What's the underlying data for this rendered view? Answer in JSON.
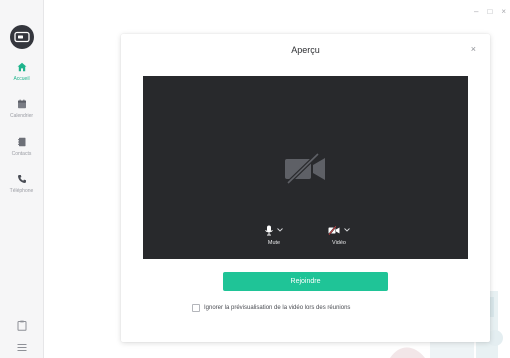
{
  "window": {
    "minimize": "–",
    "maximize": "□",
    "close": "×"
  },
  "sidebar": {
    "logo_icon": "app-logo-icon",
    "items": [
      {
        "label": "Accueil",
        "icon": "home-icon",
        "active": true
      },
      {
        "label": "Calendrier",
        "icon": "calendar-icon",
        "active": false
      },
      {
        "label": "Contacts",
        "icon": "contacts-icon",
        "active": false
      },
      {
        "label": "Téléphone",
        "icon": "phone-icon",
        "active": false
      }
    ],
    "bottom_icons": [
      "clipboard-icon",
      "menu-icon"
    ]
  },
  "dialog": {
    "title": "Aperçu",
    "close": "×",
    "preview": {
      "camera_state_icon": "camera-off-icon"
    },
    "controls": {
      "mute_label": "Mute",
      "video_label": "Vidéo"
    },
    "join_label": "Rejoindre",
    "skip_preview_label": "Ignorer la prévisualisation de la vidéo lors des réunions",
    "skip_preview_checked": false
  },
  "colors": {
    "accent": "#1fc497",
    "active_nav": "#1fb48c",
    "preview_bg": "#28292c",
    "sidebar_bg": "#f6f6f7"
  }
}
